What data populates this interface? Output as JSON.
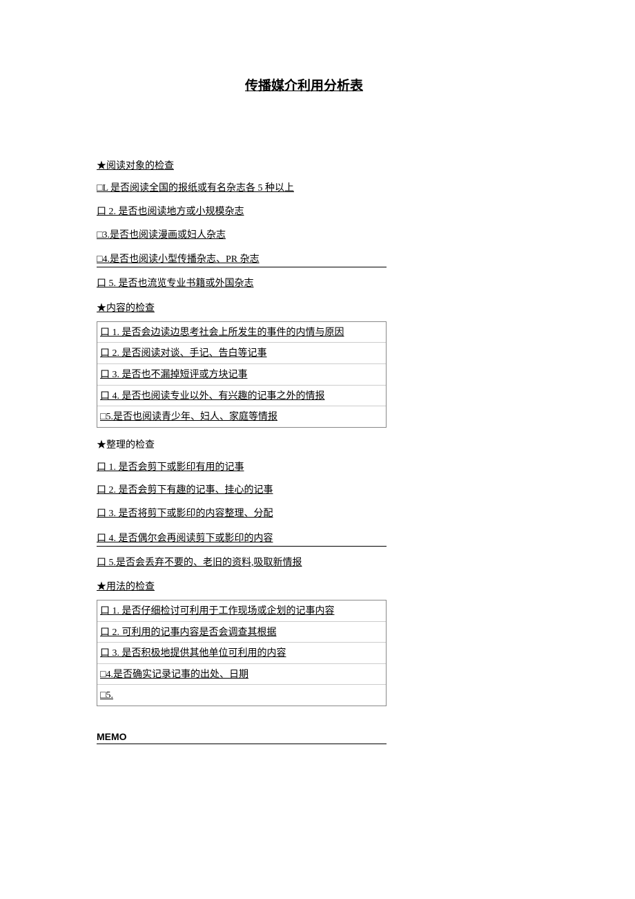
{
  "title": "传播媒介利用分析表",
  "sections": {
    "reading_target": {
      "heading": "★阅读对象的检查",
      "items": [
        "□L 是否阅读全国的报纸或有名杂志各 5 种以上",
        "口 2. 是否也阅读地方或小规模杂志",
        "□3.是否也阅读漫画或妇人杂志",
        "□4.是否也阅读小型传播杂志、PR 杂志",
        "口 5. 是否也流览专业书籍或外国杂志"
      ]
    },
    "content_check": {
      "heading": "★内容的检查",
      "items": [
        "口 1. 是否会边读边思考社会上所发生的事件的内情与原因",
        "口 2. 是否阅读对谈、手记、告白等记事",
        "口 3. 是否也不漏掉短评或方块记事",
        "口 4. 是否也阅读专业以外、有兴趣的记事之外的情报",
        "□5.是否也阅读青少年、妇人、家庭等情报"
      ]
    },
    "organize_check": {
      "heading": "★整理的检查",
      "items": [
        "口 1. 是否会剪下或影印有用的记事",
        "口 2. 是否会剪下有趣的记事、挂心的记事",
        "口 3. 是否将剪下或影印的内容整理、分配",
        "口 4. 是否偶尔会再阅读剪下或影印的内容",
        "口 5.是否会丢弃不要的、老旧的资料,吸取新情报"
      ]
    },
    "usage_check": {
      "heading": "★用法的检查",
      "items": [
        "口 1. 是否仔细检讨可利用于工作现场或企划的记事内容",
        "口 2. 可利用的记事内容是否会调查其根据",
        "口 3. 是否积极地提供其他单位可利用的内容",
        "□4.是否确实记录记事的出处、日期",
        "□5."
      ]
    }
  },
  "memo_label": "MEMO"
}
